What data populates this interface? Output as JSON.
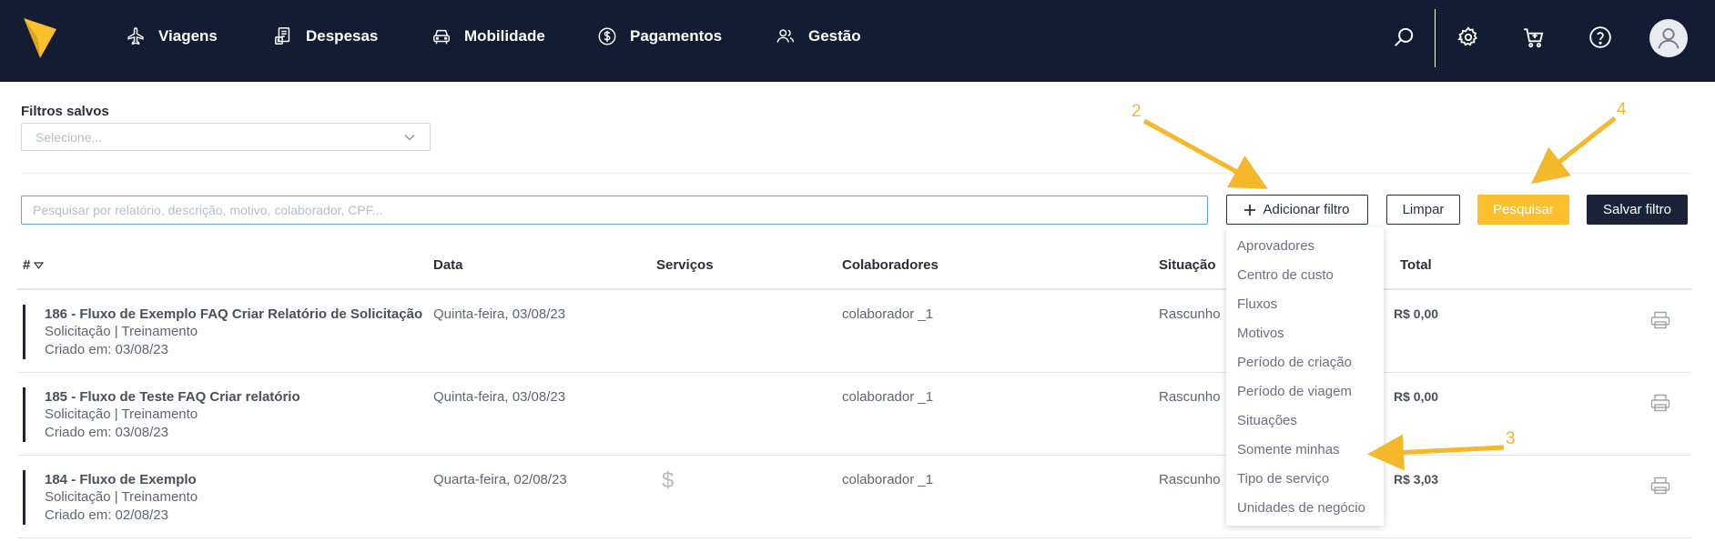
{
  "nav": {
    "items": [
      {
        "label": "Viagens",
        "icon": "plane-icon"
      },
      {
        "label": "Despesas",
        "icon": "receipt-icon"
      },
      {
        "label": "Mobilidade",
        "icon": "car-icon"
      },
      {
        "label": "Pagamentos",
        "icon": "dollar-circle-icon"
      },
      {
        "label": "Gestão",
        "icon": "users-icon"
      }
    ],
    "right_icons": [
      "search-icon",
      "gear-icon",
      "cart-icon",
      "help-icon",
      "avatar-icon"
    ]
  },
  "filters": {
    "saved_label": "Filtros salvos",
    "saved_placeholder": "Selecione..."
  },
  "search": {
    "placeholder": "Pesquisar por relatório, descrição, motivo, colaborador, CPF...",
    "add_filter_label": "Adicionar filtro",
    "clear_label": "Limpar",
    "search_label": "Pesquisar",
    "save_filter_label": "Salvar filtro"
  },
  "table": {
    "headers": {
      "number": "#",
      "date": "Data",
      "services": "Serviços",
      "collaborators": "Colaboradores",
      "status": "Situação",
      "total": "Total"
    },
    "rows": [
      {
        "title": "186 - Fluxo de Exemplo FAQ Criar Relatório de Solicitação",
        "type": "Solicitação | Treinamento",
        "created": "Criado em: 03/08/23",
        "date": "Quinta-feira, 03/08/23",
        "service_icon": "",
        "collaborator": "colaborador _1",
        "status": "Rascunho",
        "total": "R$ 0,00"
      },
      {
        "title": "185 - Fluxo de Teste FAQ Criar relatório",
        "type": "Solicitação | Treinamento",
        "created": "Criado em: 03/08/23",
        "date": "Quinta-feira, 03/08/23",
        "service_icon": "",
        "collaborator": "colaborador _1",
        "status": "Rascunho",
        "total": "R$ 0,00"
      },
      {
        "title": "184 - Fluxo de Exemplo",
        "type": "Solicitação | Treinamento",
        "created": "Criado em: 02/08/23",
        "date": "Quarta-feira, 02/08/23",
        "service_icon": "$",
        "collaborator": "colaborador _1",
        "status": "Rascunho",
        "total": "R$ 3,03"
      }
    ]
  },
  "filter_menu": {
    "items": [
      "Aprovadores",
      "Centro de custo",
      "Fluxos",
      "Motivos",
      "Período de criação",
      "Período de viagem",
      "Situações",
      "Somente minhas",
      "Tipo de serviço",
      "Unidades de negócio"
    ]
  },
  "annotations": {
    "labels": [
      "2",
      "3",
      "4"
    ],
    "color": "#f4b82a"
  },
  "colors": {
    "topbar": "#141c33",
    "accent_yellow": "#fbc02d",
    "primary_dark": "#1b233b",
    "input_border_focus": "#5aa8d8"
  }
}
